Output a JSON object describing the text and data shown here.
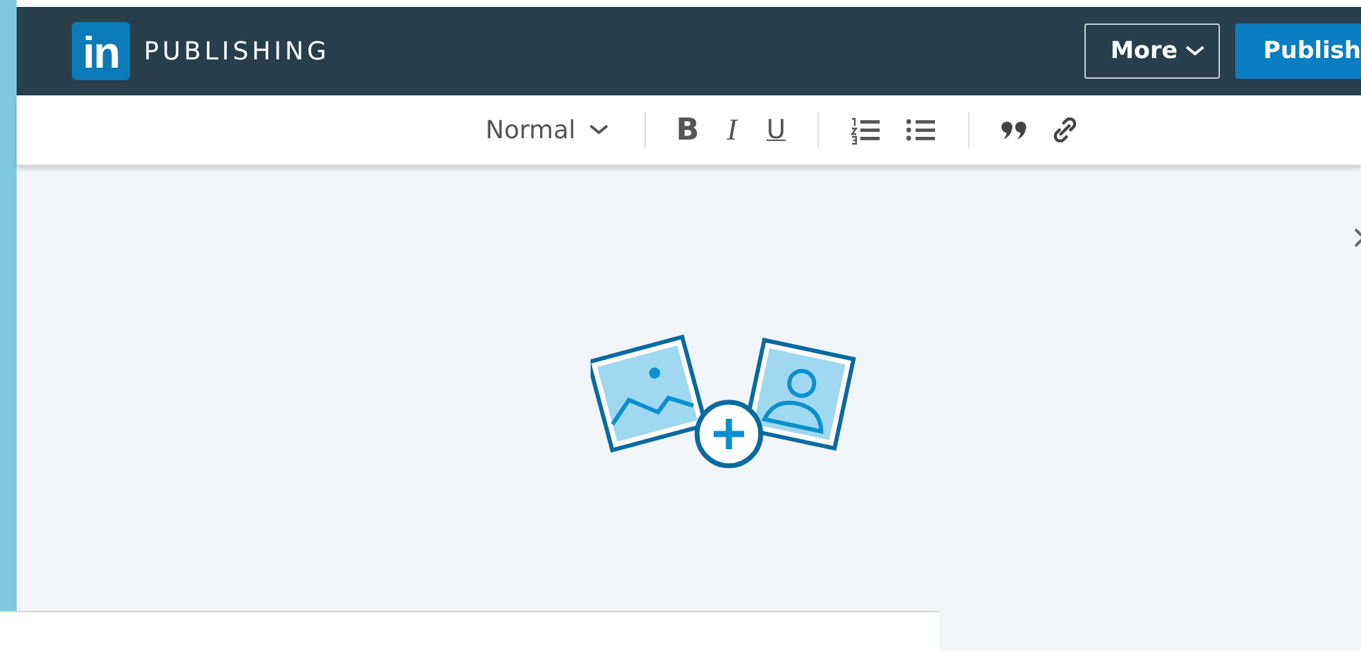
{
  "header": {
    "logo": "in",
    "title": "PUBLISHING",
    "buttons": [
      {
        "kind": "outline",
        "label": "More",
        "caret": true
      },
      {
        "kind": "primary",
        "label": "Publish",
        "caret": false
      }
    ]
  },
  "toolbar": {
    "style_dropdown": "Normal",
    "format": [
      {
        "kind": "bold",
        "label": "B"
      },
      {
        "kind": "italic",
        "label": "I"
      },
      {
        "kind": "underline",
        "label": "U"
      }
    ],
    "lists": [
      {
        "kind": "numbered"
      },
      {
        "kind": "bulleted"
      }
    ],
    "insert": [
      {
        "kind": "quote"
      },
      {
        "kind": "link"
      }
    ]
  }
}
